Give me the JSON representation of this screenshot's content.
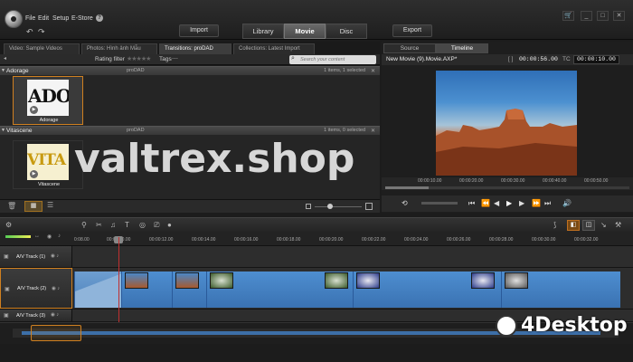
{
  "menu": {
    "file": "File",
    "edit": "Edit",
    "setup": "Setup",
    "estore": "E-Store"
  },
  "top_buttons": {
    "import": "Import",
    "export": "Export"
  },
  "main_tabs": {
    "library": "Library",
    "movie": "Movie",
    "disc": "Disc"
  },
  "library": {
    "tabs": [
      "Video: Sample Videos",
      "Photos: Hình ảnh Mẫu",
      "Transitions: proDAD",
      "Collections: Latest Import"
    ],
    "rating_filter": "Rating filter",
    "rating_stars": "★★★★★",
    "tags": "Tags",
    "search_placeholder": "Search your content",
    "groups": [
      {
        "title": "Adorage",
        "source": "proDAD",
        "count": "1 items, 1 selected",
        "item_label": "Adorage",
        "thumb_text": "ADO"
      },
      {
        "title": "Vitascene",
        "source": "proDAD",
        "count": "1 items, 0 selected",
        "item_label": "Vitascene",
        "thumb_text": "VITA"
      }
    ]
  },
  "player": {
    "tab_source": "Source",
    "tab_timeline": "Timeline",
    "title": "New Movie (9).Movie.AXP*",
    "timecode": "00:00:56.00",
    "tc_label": "TC",
    "tc_value": "00:00:10.00",
    "ruler_ticks": [
      "00:00:10.00",
      "00:00:20.00",
      "00:00:30.00",
      "00:00:40.00",
      "00:00:50.00"
    ]
  },
  "timeline": {
    "ruler_ticks": [
      "0:08.00",
      "00:00:10.00",
      "00:00:12.00",
      "00:00:14.00",
      "00:00:16.00",
      "00:00:18.00",
      "00:00:20.00",
      "00:00:22.00",
      "00:00:24.00",
      "00:00:26.00",
      "00:00:28.00",
      "00:00:30.00",
      "00:00:32.00"
    ],
    "tracks": [
      "A/V Track (1)",
      "A/V Track (2)",
      "A/V Track (3)"
    ]
  },
  "watermark": {
    "main": "valtrex.shop",
    "corner": "4Desktop"
  },
  "colors": {
    "accent": "#d08020",
    "clip": "#4e8ed0",
    "playhead": "#c03030"
  }
}
